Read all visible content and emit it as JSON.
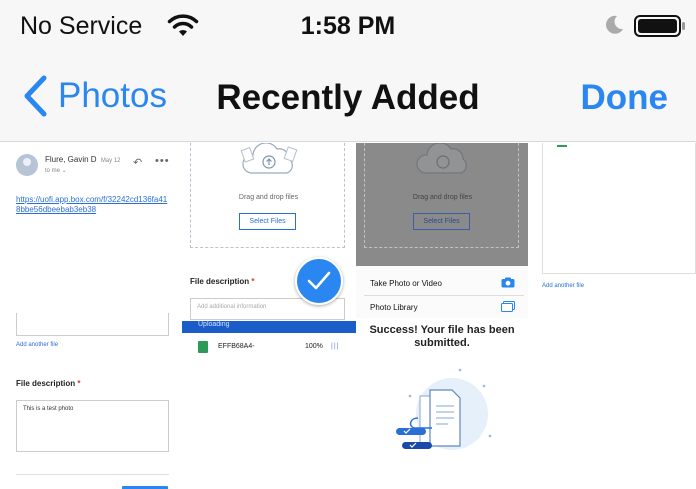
{
  "status_bar": {
    "carrier": "No Service",
    "time": "1:58 PM",
    "icons": [
      "wifi-icon",
      "moon-icon",
      "battery-icon"
    ]
  },
  "nav": {
    "back_label": "Photos",
    "title": "Recently Added",
    "done_label": "Done"
  },
  "colors": {
    "accent": "#2a86f0",
    "check_badge": "#2a86f0",
    "link": "#2a6fd6",
    "upload_bar": "#1a5dc9",
    "file_green": "#2c9b5a"
  },
  "photos": [
    {
      "sender": "Flure, Gavin D",
      "date": "May 12",
      "to": "to me",
      "link": "https://uofi.app.box.com/f/32242cd136fa418bbe56dbeebab3eb38",
      "add_link": "Add another file",
      "desc_label": "File description",
      "required_mark": "*",
      "desc_value": "This is a test photo"
    },
    {
      "drop_text": "Drag and drop files",
      "select_button": "Select Files",
      "desc_label": "File description",
      "required_mark": "*",
      "desc_placeholder": "Add additional information",
      "progress_label": "Uploading",
      "file_name": "EFFB68A4-",
      "file_progress": "100%",
      "file_bars": "|||",
      "selected": true
    },
    {
      "drop_text": "Drag and drop files",
      "select_button": "Select Files",
      "sheet_items": [
        "Take Photo or Video",
        "Photo Library"
      ],
      "success_text": "Success! Your file has been submitted."
    },
    {
      "add_link": "Add another file"
    }
  ]
}
